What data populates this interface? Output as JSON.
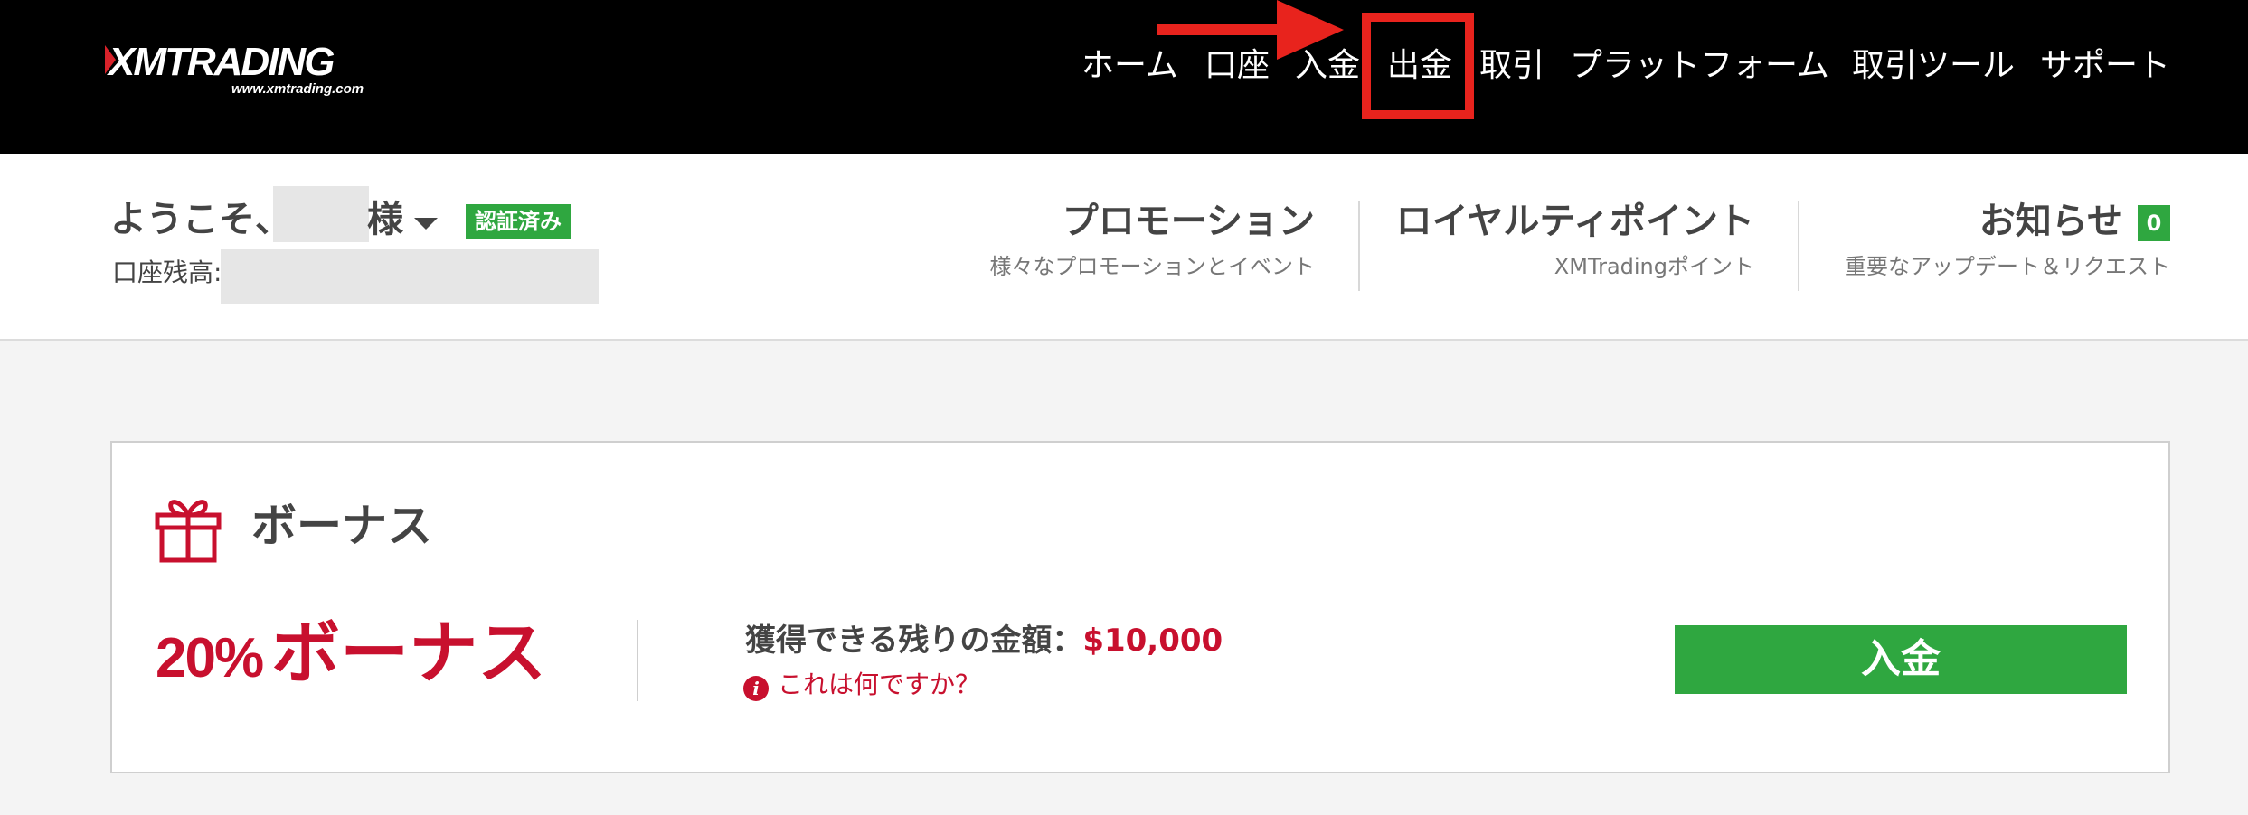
{
  "header": {
    "logo_text": "XMTRADING",
    "logo_url_text": "www.xmtrading.com",
    "nav": {
      "home": "ホーム",
      "account": "口座",
      "deposit": "入金",
      "withdrawal": "出金",
      "trading": "取引",
      "platforms": "プラットフォーム",
      "tools": "取引ツール",
      "support": "サポート"
    }
  },
  "user": {
    "welcome": "ようこそ、",
    "honorific": "様",
    "verified_badge": "認証済み",
    "balance_label": "口座残高:"
  },
  "links": {
    "promotions": {
      "title": "プロモーション",
      "subtitle": "様々なプロモーションとイベント"
    },
    "loyalty": {
      "title": "ロイヤルティポイント",
      "subtitle": "XMTradingポイント"
    },
    "news": {
      "title": "お知らせ",
      "count": "0",
      "subtitle": "重要なアップデート＆リクエスト"
    }
  },
  "bonus_card": {
    "title": "ボーナス",
    "percent": "20%",
    "bonus_text": "ボーナス",
    "remaining_label": "獲得できる残りの金額：",
    "remaining_amount": "$10,000",
    "info_link": "これは何ですか？",
    "deposit_button": "入金"
  },
  "colors": {
    "brand_red": "#c8102e",
    "annotation_red": "#e8231d",
    "success_green": "#2fa740",
    "nav_bg": "#000000"
  },
  "icons": {
    "gift": "gift-icon",
    "info": "info-icon",
    "caret": "caret-down-icon"
  }
}
